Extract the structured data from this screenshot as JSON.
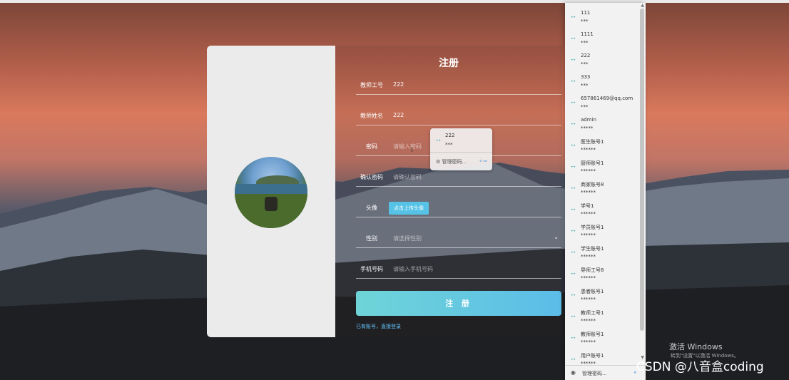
{
  "register": {
    "title": "注册",
    "fields": [
      {
        "label": "教师工号",
        "value": "222"
      },
      {
        "label": "教师姓名",
        "value": "222"
      },
      {
        "label": "密码",
        "placeholder": "请输入密码"
      },
      {
        "label": "确认密码",
        "placeholder": "请确认密码"
      },
      {
        "label": "头像",
        "button": "点击上传头像"
      },
      {
        "label": "性别",
        "placeholder": "请选择性别"
      },
      {
        "label": "手机号码",
        "placeholder": "请输入手机号码"
      }
    ],
    "submit": "注 册",
    "login_link": "已有账号，直接登录"
  },
  "mini_popup": {
    "username": "222",
    "password": "***",
    "manage": "管理密码..."
  },
  "dropdown": {
    "items": [
      {
        "u": "111",
        "p": "***"
      },
      {
        "u": "1111",
        "p": "***"
      },
      {
        "u": "222",
        "p": "***"
      },
      {
        "u": "333",
        "p": "***"
      },
      {
        "u": "657861469@qq.com",
        "p": "***"
      },
      {
        "u": "admin",
        "p": "*****"
      },
      {
        "u": "医生账号1",
        "p": "******"
      },
      {
        "u": "厨师账号1",
        "p": "******"
      },
      {
        "u": "商家账号8",
        "p": "******"
      },
      {
        "u": "学号1",
        "p": "******"
      },
      {
        "u": "学员账号1",
        "p": "******"
      },
      {
        "u": "学生账号1",
        "p": "******"
      },
      {
        "u": "导师工号8",
        "p": "******"
      },
      {
        "u": "患者账号1",
        "p": "******"
      },
      {
        "u": "教师工号1",
        "p": "******"
      },
      {
        "u": "教师账号1",
        "p": "******"
      },
      {
        "u": "用户账号1",
        "p": "******"
      }
    ],
    "manage": "管理密码..."
  },
  "watermark": {
    "line1": "激活 Windows",
    "line2": "转到\"设置\"以激活 Windows。",
    "csdn": "CSDN @八音盒coding"
  }
}
